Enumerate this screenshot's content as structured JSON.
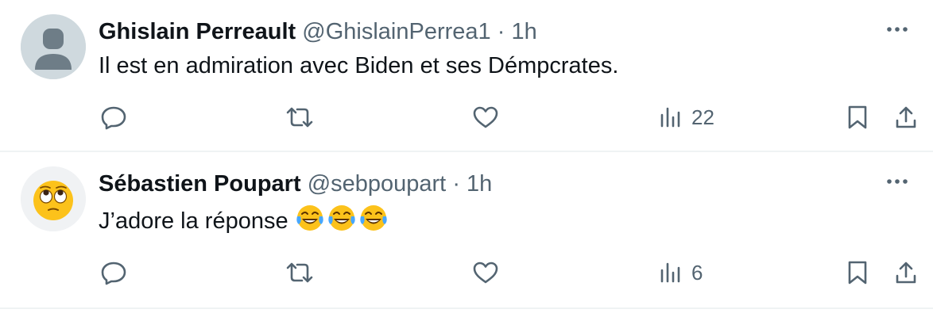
{
  "tweets": [
    {
      "author_name": "Ghislain Perreault",
      "handle": "@GhislainPerrea1",
      "separator": "·",
      "time": "1h",
      "text": "Il est en admiration avec Biden et ses Démpcrates.",
      "views": "22",
      "avatar": "default-avatar-icon"
    },
    {
      "author_name": "Sébastien Poupart",
      "handle": "@sebpoupart",
      "separator": "·",
      "time": "1h",
      "text": "J’adore la réponse",
      "emoji_count": 3,
      "emoji": "face-with-tears-of-joy-icon",
      "views": "6",
      "avatar": "face-with-rolling-eyes-icon"
    }
  ],
  "colors": {
    "text": "#0f1419",
    "secondary": "#536471",
    "divider": "#eff3f4",
    "default_avatar_bg": "#cfd9de",
    "default_avatar_fg": "#6e7d87"
  }
}
